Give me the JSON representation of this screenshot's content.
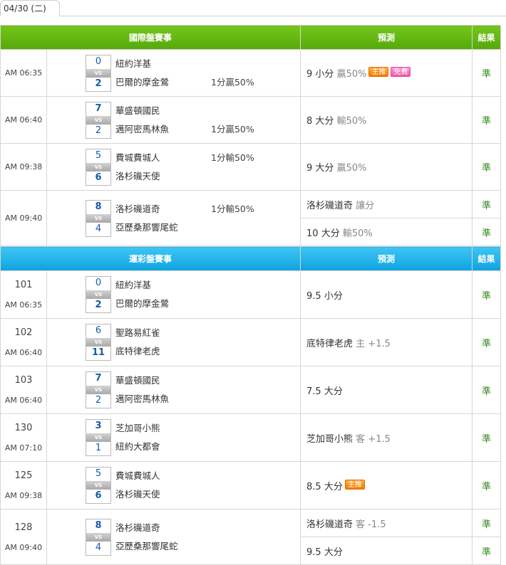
{
  "tab": {
    "date": "04/30 (二)"
  },
  "intl": {
    "header": {
      "event": "國際盤賽事",
      "prediction": "預測",
      "result": "結果"
    },
    "games": [
      {
        "time": "AM 06:35",
        "away_score": "0",
        "home_score": "2",
        "away": "紐約洋基",
        "home": "巴爾的摩金鶯",
        "handicap": "1分贏50%",
        "hc_pos": "bottom",
        "preds": [
          {
            "main": "9 小分",
            "sub": "贏50%",
            "badges": [
              "主推",
              "免費"
            ],
            "result": "準"
          }
        ]
      },
      {
        "time": "AM 06:40",
        "away_score": "7",
        "home_score": "2",
        "away": "華盛頓國民",
        "home": "邁阿密馬林魚",
        "handicap": "1分贏50%",
        "hc_pos": "bottom",
        "preds": [
          {
            "main": "8 大分",
            "sub": "輸50%",
            "badges": [],
            "result": "準"
          }
        ]
      },
      {
        "time": "AM 09:38",
        "away_score": "5",
        "home_score": "6",
        "away": "費城費城人",
        "home": "洛杉磯天使",
        "handicap": "1分輸50%",
        "hc_pos": "top",
        "preds": [
          {
            "main": "9 大分",
            "sub": "贏50%",
            "badges": [],
            "result": "準"
          }
        ]
      },
      {
        "time": "AM 09:40",
        "away_score": "8",
        "home_score": "4",
        "away": "洛杉磯道奇",
        "home": "亞歷桑那響尾蛇",
        "handicap": "1分輸50%",
        "hc_pos": "top",
        "preds": [
          {
            "main": "洛杉磯道奇",
            "sub": "讓分",
            "badges": [],
            "result": "準"
          },
          {
            "main": "10 大分",
            "sub": "輸50%",
            "badges": [],
            "result": "準"
          }
        ]
      }
    ]
  },
  "lottery": {
    "header": {
      "event": "運彩盤賽事",
      "prediction": "預測",
      "result": "結果"
    },
    "games": [
      {
        "no": "101",
        "time": "AM 06:35",
        "away_score": "0",
        "home_score": "2",
        "away": "紐約洋基",
        "home": "巴爾的摩金鶯",
        "preds": [
          {
            "main": "9.5 小分",
            "sub": "",
            "badges": [],
            "result": "準"
          }
        ]
      },
      {
        "no": "102",
        "time": "AM 06:40",
        "away_score": "6",
        "home_score": "11",
        "away": "聖路易紅雀",
        "home": "底特律老虎",
        "preds": [
          {
            "main": "底特律老虎",
            "sub": "主 +1.5",
            "badges": [],
            "result": "準"
          }
        ]
      },
      {
        "no": "103",
        "time": "AM 06:40",
        "away_score": "7",
        "home_score": "2",
        "away": "華盛頓國民",
        "home": "邁阿密馬林魚",
        "preds": [
          {
            "main": "7.5 大分",
            "sub": "",
            "badges": [],
            "result": "準"
          }
        ]
      },
      {
        "no": "130",
        "time": "AM 07:10",
        "away_score": "3",
        "home_score": "1",
        "away": "芝加哥小熊",
        "home": "紐約大都會",
        "preds": [
          {
            "main": "芝加哥小熊",
            "sub": "客 +1.5",
            "badges": [],
            "result": "準"
          }
        ]
      },
      {
        "no": "125",
        "time": "AM 09:38",
        "away_score": "5",
        "home_score": "6",
        "away": "費城費城人",
        "home": "洛杉磯天使",
        "preds": [
          {
            "main": "8.5 大分",
            "sub": "",
            "badges": [
              "主推"
            ],
            "result": "準"
          }
        ]
      },
      {
        "no": "128",
        "time": "AM 09:40",
        "away_score": "8",
        "home_score": "4",
        "away": "洛杉磯道奇",
        "home": "亞歷桑那響尾蛇",
        "preds": [
          {
            "main": "洛杉磯道奇",
            "sub": "客 -1.5",
            "badges": [],
            "result": "準"
          },
          {
            "main": "9.5 大分",
            "sub": "",
            "badges": [],
            "result": "準"
          }
        ]
      }
    ]
  },
  "colors": {
    "intl_header": "#5fb312",
    "lottery_header": "#1aaae6",
    "result_text": "#2e8b1e",
    "score_text": "#1a5aa8",
    "badge_main": "#f07a00",
    "badge_free": "#f056a8"
  },
  "badge_styles": {
    "主推": "orange",
    "免費": "pink"
  }
}
